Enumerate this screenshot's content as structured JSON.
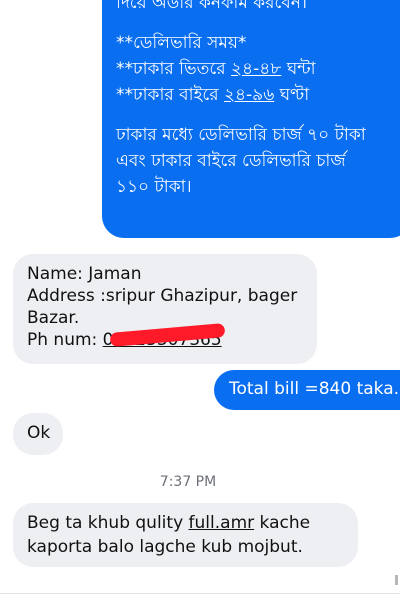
{
  "conversation": {
    "delivery_message": {
      "line_top_clipped": "দিয়ে অর্ডার কনফার্ম করবেন।",
      "delivery_time_heading": "**ডেলিভারি সময়*",
      "inside_dhaka_prefix": "**ঢাকার ভিতরে ",
      "inside_dhaka_hours": "২৪-৪৮",
      "inside_dhaka_unit": " ঘন্টা",
      "outside_dhaka_prefix": "**ঢাকার বাইরে ",
      "outside_dhaka_hours": "২৪-৯৬",
      "outside_dhaka_unit": " ঘণ্টা",
      "charge_line_1": "ঢাকার মধ্যে ডেলিভারি চার্জ ৭০ টাকা",
      "charge_line_2": "এবং ঢাকার বাইরে ডেলিভারি চার্জ",
      "charge_line_3": "১১০ টাকা।"
    },
    "address_message": {
      "name_line": "Name: Jaman",
      "address_line_1": "Address :sripur Ghazipur, bager",
      "address_line_2": "Bazar.",
      "phone_label": "Ph num: ",
      "phone_visible": "01923307365"
    },
    "total_message": {
      "text": "Total bill =840 taka."
    },
    "ok_message": {
      "text": "Ok"
    },
    "timestamp": "7:37 PM",
    "review_message": {
      "line_1_prefix": "Beg ta khub qulity ",
      "line_1_link": "full.amr",
      "line_1_suffix": " kache",
      "line_2": "kaporta balo lagche kub mojbut."
    }
  },
  "colors": {
    "outgoing_bubble": "#0a6ef0",
    "incoming_bubble": "#eeeff3",
    "redaction_mark": "#ff1a2a",
    "timestamp_text": "#6b6f77"
  }
}
